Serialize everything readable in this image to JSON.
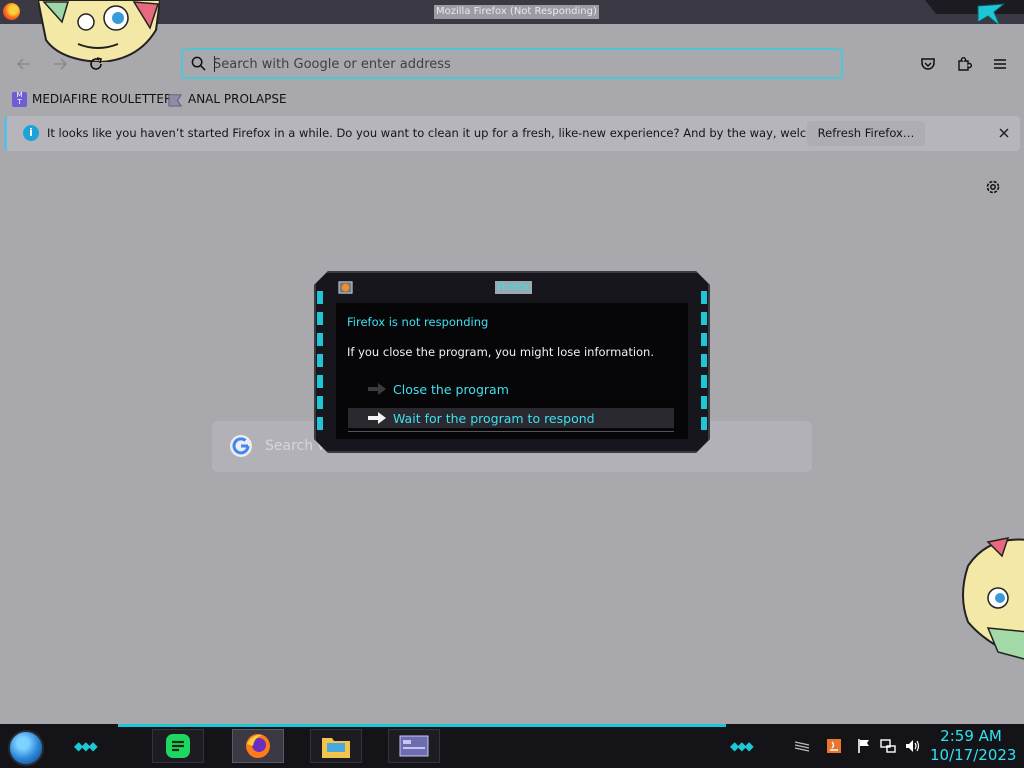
{
  "window": {
    "title": "Mozilla Firefox (Not Responding)"
  },
  "navbar": {
    "back": "Back",
    "forward": "Forward",
    "reload": "Reload",
    "urlbar_placeholder": "Search with Google or enter address",
    "pocket": "Save to Pocket",
    "extensions": "Extensions",
    "menu": "Open application menu"
  },
  "bookmarks": [
    {
      "label": "MEDIAFIRE ROULETTER",
      "icon": "mediafire-icon"
    },
    {
      "label": "ANAL PROLAPSE",
      "icon": "folder-icon"
    }
  ],
  "notification": {
    "message": "It looks like you haven’t started Firefox in a while. Do you want to clean it up for a fresh, like-new experience? And by the way, welcome back!",
    "button": "Refresh Firefox…"
  },
  "newtab": {
    "search_placeholder": "Search w"
  },
  "dialog": {
    "title": "Firefox",
    "heading": "Firefox is not responding",
    "body": "If you close the program, you might lose information.",
    "option_close": "Close the program",
    "option_wait": "Wait for the program to respond"
  },
  "taskbar": {
    "time": "2:59 AM",
    "date": "10/17/2023"
  },
  "colors": {
    "accent": "#1fc7d4",
    "page_bg": "#a9a8ad",
    "dialog_bg": "#060608"
  }
}
